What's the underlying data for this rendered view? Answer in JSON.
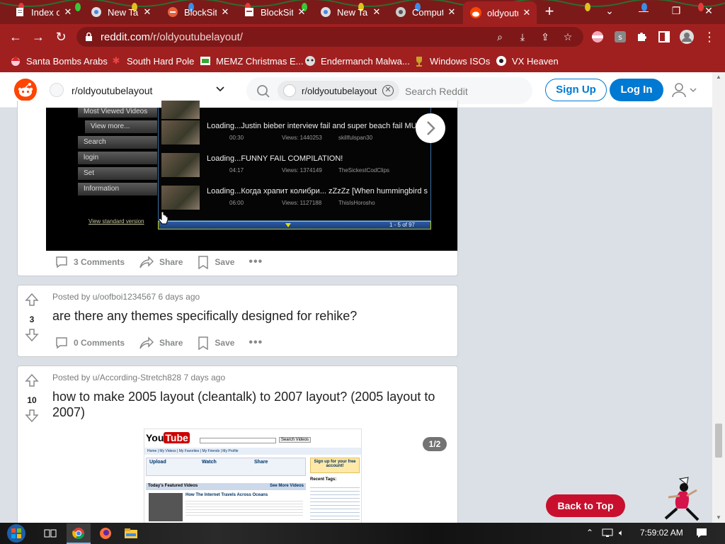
{
  "browser": {
    "tabs": [
      {
        "title": "Index of",
        "icon": "file-index-icon"
      },
      {
        "title": "New Tab",
        "icon": "chrome-icon"
      },
      {
        "title": "BlockSite",
        "icon": "blocksite-shield-icon"
      },
      {
        "title": "BlockSite",
        "icon": "blocksite-page-icon"
      },
      {
        "title": "New Tab",
        "icon": "chrome-icon"
      },
      {
        "title": "Computer",
        "icon": "computer-icon"
      },
      {
        "title": "oldyoutubelayout",
        "icon": "reddit-icon",
        "active": true
      }
    ],
    "url": "reddit.com/r/oldyoutubelayout/",
    "url_host": "reddit.com",
    "url_path": "/r/oldyoutubelayout/",
    "bookmarks": [
      {
        "label": "Santa Bombs Arabs",
        "icon": "santa-icon"
      },
      {
        "label": "South Hard Pole",
        "icon": "snowflake-icon"
      },
      {
        "label": "MEMZ Christmas E...",
        "icon": "memz-icon"
      },
      {
        "label": "Endermanch Malwa...",
        "icon": "endermanch-icon"
      },
      {
        "label": "Windows ISOs",
        "icon": "trophy-icon"
      },
      {
        "label": "VX Heaven",
        "icon": "vx-heaven-icon"
      }
    ],
    "accent": "#a02020"
  },
  "reddit": {
    "subreddit": "r/oldyoutubelayout",
    "search_chip": "r/oldyoutubelayout",
    "search_placeholder": "Search Reddit",
    "signup_label": "Sign Up",
    "login_label": "Log In",
    "back_to_top": "Back to Top",
    "posts": [
      {
        "comments": "3 Comments",
        "share": "Share",
        "save": "Save",
        "media": {
          "side_menu": [
            "Most Viewed Videos",
            "View more...",
            "Search",
            "login",
            "Set",
            "Information"
          ],
          "standard_link": "View standard version",
          "videos": [
            {
              "title": "",
              "duration": "",
              "views": "",
              "channel": ""
            },
            {
              "title": "Loading...Justin bieber interview fail and super beach fail MUST",
              "duration": "00:30",
              "views": "Views: 1440253",
              "channel": "skillfulspan30"
            },
            {
              "title": "Loading...FUNNY FAIL COMPILATION!",
              "duration": "04:17",
              "views": "Views: 1374149",
              "channel": "TheSickestCodClips"
            },
            {
              "title": "Loading...Когда храпит колибри... zZzZz [When hummingbird s...",
              "duration": "06:00",
              "views": "Views: 1127188",
              "channel": "ThisIsHorosho"
            }
          ],
          "page_counter": "1 - 5 of 97"
        }
      },
      {
        "score": "3",
        "meta": "Posted by u/oofboi1234567 6 days ago",
        "title": "are there any themes specifically designed for rehike?",
        "comments": "0 Comments",
        "share": "Share",
        "save": "Save"
      },
      {
        "score": "10",
        "meta": "Posted by u/According-Stretch828 7 days ago",
        "title": "how to make 2005 layout (cleantalk) to 2007 layout? (2005 layout to 2007)",
        "image_counter": "1/2",
        "preview": {
          "logo_you": "You",
          "logo_tube": "Tube",
          "search_button": "Search Videos",
          "nav": [
            "Home",
            "My Videos",
            "My Favorites",
            "My Friends",
            "My Profile"
          ],
          "cols": [
            "Upload",
            "Watch",
            "Share"
          ],
          "signup": "Sign up for your free account!",
          "featured": "Today's Featured Videos",
          "see_more": "See More Videos",
          "featured_title": "How The Internet Travels Across Oceans",
          "recent_tags": "Recent Tags:"
        }
      }
    ]
  },
  "taskbar": {
    "time": "7:59:02 AM"
  }
}
